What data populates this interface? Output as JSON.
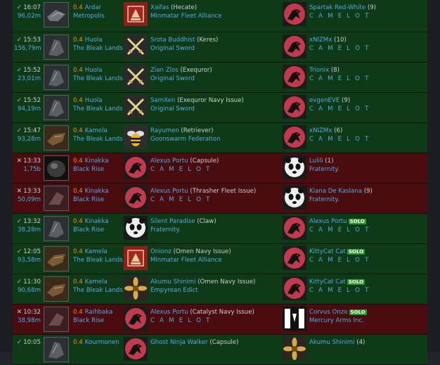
{
  "rows": [
    {
      "type": "win",
      "mark": "✓",
      "time": "16:07",
      "value": "96,02m",
      "sec": "0.4",
      "system": "Ardar",
      "region": "Metropolis",
      "victim_name": "Xaifas",
      "victim_ship": "(Hecate)",
      "victim_corp": "Minmatar Fleet Alliance",
      "victim_logo": "minmatar-logo",
      "final_name": "Spartak Red-White",
      "final_extra": "(9)",
      "final_corp": "C A M E L O T",
      "final_logo": "camelot-raven-logo"
    },
    {
      "type": "win",
      "mark": "✓",
      "time": "15:53",
      "value": "156,79m",
      "sec": "0.4",
      "system": "Huola",
      "region": "The Bleak Lands",
      "victim_name": "Srota Buddhist",
      "victim_ship": "(Keres)",
      "victim_corp": "Original Sword",
      "victim_logo": "crossed-swords-logo",
      "final_name": "xNIZMx",
      "final_extra": "(10)",
      "final_corp": "C A M E L O T",
      "final_logo": "camelot-raven-logo"
    },
    {
      "type": "win",
      "mark": "✓",
      "time": "15:52",
      "value": "23,01m",
      "sec": "0.4",
      "system": "Huola",
      "region": "The Bleak Lands",
      "victim_name": "Zian Zlos",
      "victim_ship": "(Exequror)",
      "victim_corp": "Original Sword",
      "victim_logo": "crossed-swords-logo",
      "final_name": "Trionix",
      "final_extra": "(8)",
      "final_corp": "C A M E L O T",
      "final_logo": "camelot-raven-logo"
    },
    {
      "type": "win",
      "mark": "✓",
      "time": "15:52",
      "value": "94,19m",
      "sec": "0.4",
      "system": "Huola",
      "region": "The Bleak Lands",
      "victim_name": "SamXen",
      "victim_ship": "(Exequror Navy Issue)",
      "victim_corp": "Original Sword",
      "victim_logo": "crossed-swords-logo",
      "final_name": "evgenEVE",
      "final_extra": "(9)",
      "final_corp": "C A M E L O T",
      "final_logo": "camelot-raven-logo"
    },
    {
      "type": "win",
      "mark": "✓",
      "time": "15:47",
      "value": "93,28m",
      "sec": "0.4",
      "system": "Kamela",
      "region": "The Bleak Lands",
      "victim_name": "Rayumen",
      "victim_ship": "(Retriever)",
      "victim_corp": "Goonswarm Federation",
      "victim_logo": "bee-logo",
      "final_name": "xNIZMx",
      "final_extra": "(6)",
      "final_corp": "C A M E L O T",
      "final_logo": "camelot-raven-logo"
    },
    {
      "type": "loss",
      "mark": "✕",
      "time": "13:33",
      "value": "1,75b",
      "sec": "0.4",
      "system": "Kinakka",
      "region": "Black Rise",
      "victim_name": "Alexus Portu",
      "victim_ship": "(Capsule)",
      "victim_corp": "C A M E L O T",
      "victim_logo": "camelot-raven-logo",
      "final_name": "Lulili",
      "final_extra": "(1)",
      "final_corp": "Fraternity.",
      "final_logo": "panda-logo"
    },
    {
      "type": "loss",
      "mark": "✕",
      "time": "13:33",
      "value": "50,09m",
      "sec": "0.4",
      "system": "Kinakka",
      "region": "Black Rise",
      "victim_name": "Alexus Portu",
      "victim_ship": "(Thrasher Fleet Issue)",
      "victim_corp": "C A M E L O T",
      "victim_logo": "camelot-raven-logo",
      "final_name": "Kiana De Kaslana",
      "final_extra": "(9)",
      "final_corp": "Fraternity.",
      "final_logo": "panda-logo"
    },
    {
      "type": "win",
      "mark": "✓",
      "time": "13:32",
      "value": "38,28m",
      "sec": "0.4",
      "system": "Kinakka",
      "region": "Black Rise",
      "victim_name": "Silent Paradise",
      "victim_ship": "(Claw)",
      "victim_corp": "Fraternity.",
      "victim_logo": "panda-logo",
      "final_name": "Alexus Portu",
      "final_solo": "SOLO",
      "final_corp": "C A M E L O T",
      "final_logo": "camelot-raven-logo"
    },
    {
      "type": "win",
      "mark": "✓",
      "time": "12:05",
      "value": "93,58m",
      "sec": "0.4",
      "system": "Kamela",
      "region": "The Bleak Lands",
      "victim_name": "Onionz",
      "victim_ship": "(Omen Navy Issue)",
      "victim_corp": "Minmatar Fleet Alliance",
      "victim_logo": "minmatar-logo",
      "final_name": "KittyCat Cat",
      "final_solo": "SOLO",
      "final_corp": "C A M E L O T",
      "final_logo": "camelot-raven-logo"
    },
    {
      "type": "win",
      "mark": "✓",
      "time": "11:30",
      "value": "90,68m",
      "sec": "0.4",
      "system": "Kamela",
      "region": "The Bleak Lands",
      "victim_name": "Akumu Shinimi",
      "victim_ship": "(Omen Navy Issue)",
      "victim_corp": "Empyrean Edict",
      "victim_logo": "flower-logo",
      "final_name": "KittyCat Cat",
      "final_solo": "SOLO",
      "final_corp": "C A M E L O T",
      "final_logo": "camelot-raven-logo"
    },
    {
      "type": "loss",
      "mark": "✕",
      "time": "10:32",
      "value": "38,98m",
      "sec": "0.4",
      "system": "Raihbaka",
      "region": "Black Rise",
      "victim_name": "Alexus Portu",
      "victim_ship": "(Catalyst Navy Issue)",
      "victim_corp": "C A M E L O T",
      "victim_logo": "camelot-raven-logo",
      "final_name": "Corvus Onzo",
      "final_solo": "SOLO",
      "final_corp": "Mercury Arms Inc.",
      "final_logo": "mercury-logo"
    },
    {
      "type": "win",
      "mark": "✓",
      "time": "10:05",
      "value": "",
      "sec": "0.4",
      "system": "Kourmonen",
      "region": "",
      "victim_name": "Ghost Ninja Walker",
      "victim_ship": "(Capsule)",
      "victim_corp": "",
      "victim_logo": "camelot-raven-logo",
      "final_name": "Akumu Shinimi",
      "final_extra": "(4)",
      "final_corp": "",
      "final_logo": "flower-logo"
    }
  ],
  "colors": {
    "win": "#0f3a17",
    "loss": "#4a0c0f",
    "link": "#4fa9e6",
    "security": "#f08a2a",
    "solo": "#2a9a2a"
  }
}
